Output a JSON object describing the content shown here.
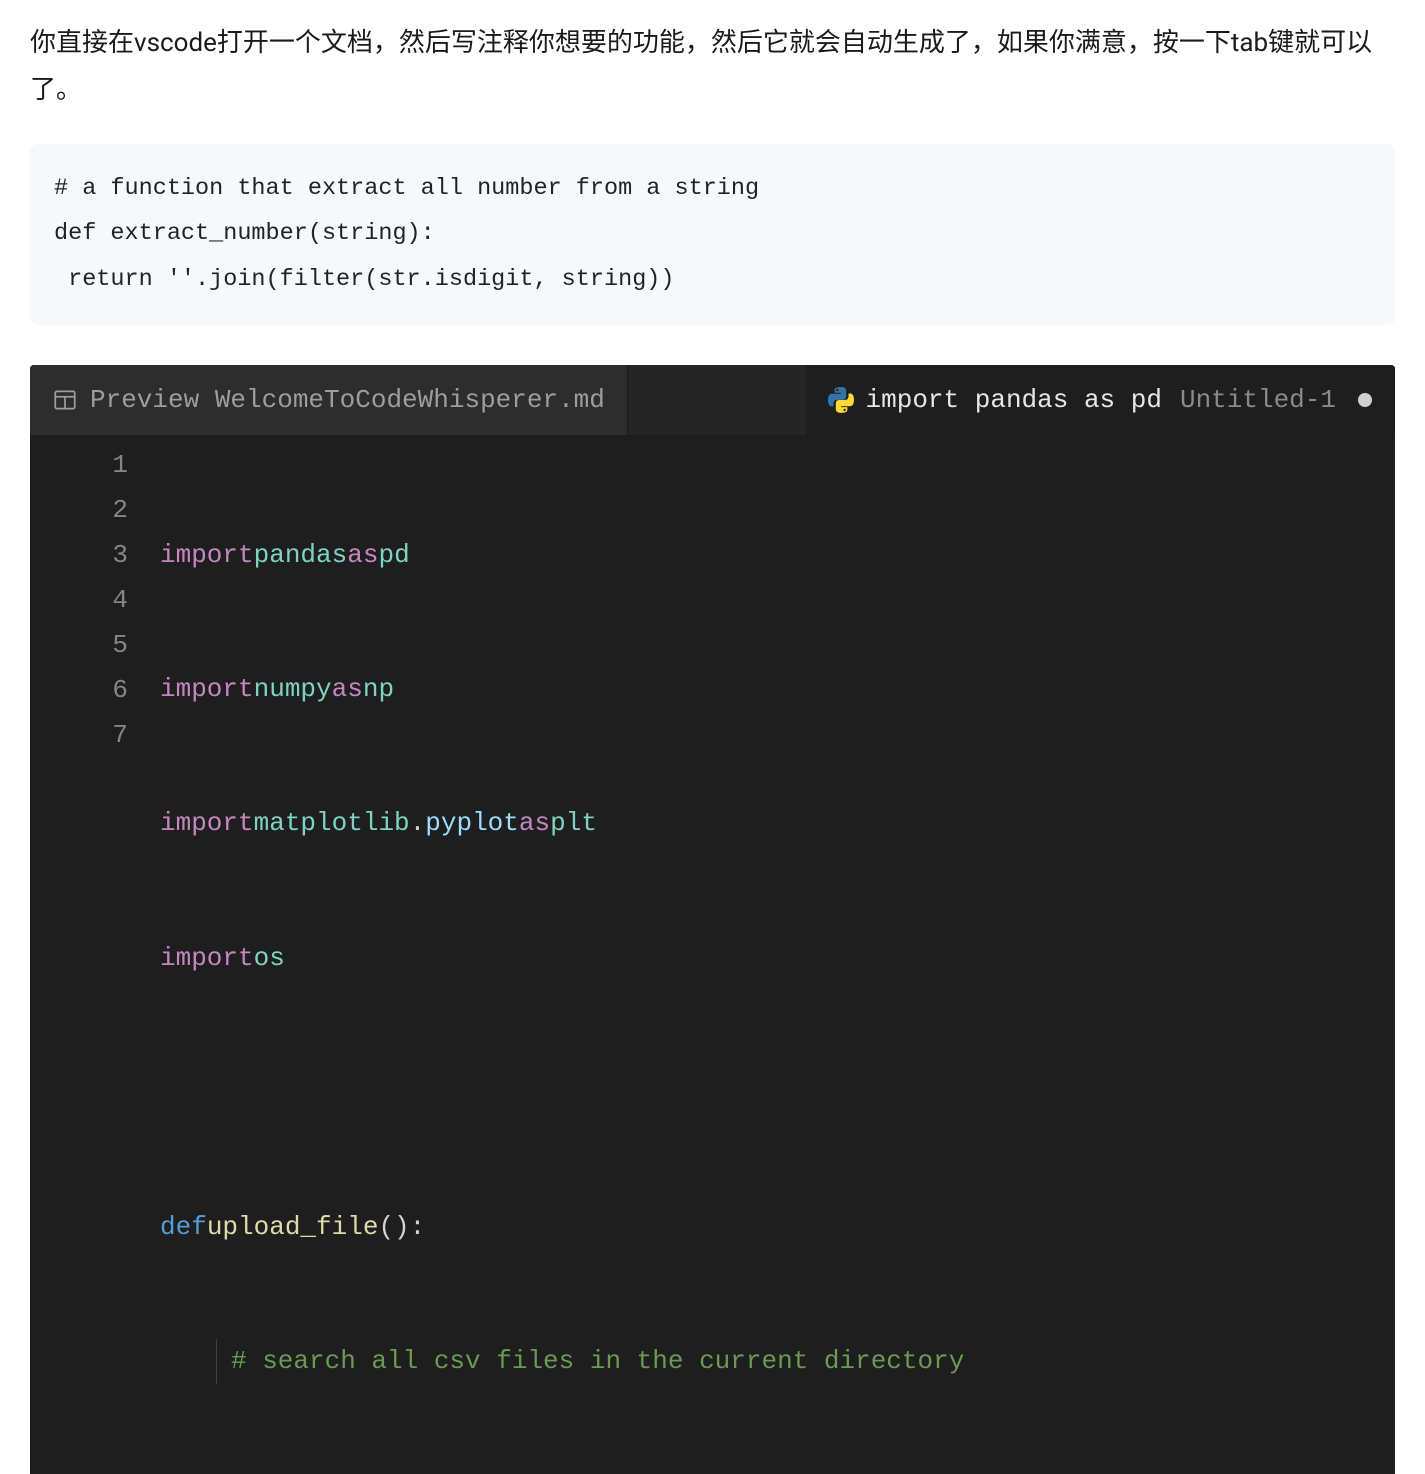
{
  "description": {
    "line1": "你直接在vscode打开一个文档，然后写注释你想要的功能，然后它就会自动生成了，如果你满意，按一下tab键就可以了。"
  },
  "light_code": {
    "line1": "# a function that extract all number from a string",
    "line2": "def extract_number(string):",
    "line3": " return ''.join(filter(str.isdigit, string))"
  },
  "tabs": {
    "preview_label": "Preview WelcomeToCodeWhisperer.md",
    "active_title": "import pandas as pd",
    "active_secondary": "Untitled-1"
  },
  "gutter": [
    "1",
    "2",
    "3",
    "4",
    "5",
    "6",
    "7"
  ],
  "code": {
    "l1": {
      "kw": "import",
      "mod": "pandas",
      "as": "as",
      "alias": "pd"
    },
    "l2": {
      "kw": "import",
      "mod": "numpy",
      "as": "as",
      "alias": "np"
    },
    "l3": {
      "kw": "import",
      "mod": "matplotlib",
      "dot": ".",
      "sub": "pyplot",
      "as": "as",
      "alias": "plt"
    },
    "l4": {
      "kw": "import",
      "mod": "os"
    },
    "l6": {
      "def": "def",
      "name": "upload_file",
      "paren": "():"
    },
    "l7": {
      "comment": "# search all csv files in the current directory"
    }
  }
}
